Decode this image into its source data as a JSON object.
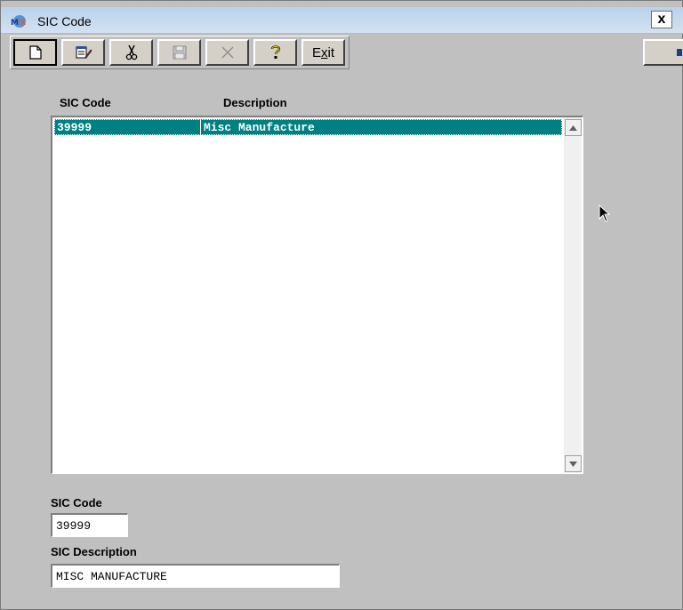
{
  "window": {
    "title": "SIC Code",
    "close_label": "x"
  },
  "toolbar": {
    "exit_prefix": "E",
    "exit_underlined": "x",
    "exit_suffix": "it"
  },
  "list": {
    "headers": {
      "code": "SIC Code",
      "description": "Description"
    },
    "rows": [
      {
        "code": "39999",
        "description": "Misc Manufacture"
      }
    ]
  },
  "form": {
    "sic_code_label": "SIC Code",
    "sic_code_value": "39999",
    "sic_description_label": "SIC Description",
    "sic_description_value": "MISC MANUFACTURE"
  },
  "colors": {
    "selection": "#008080",
    "background": "#c0c0c0",
    "titlebar": "#c4d9ee"
  }
}
